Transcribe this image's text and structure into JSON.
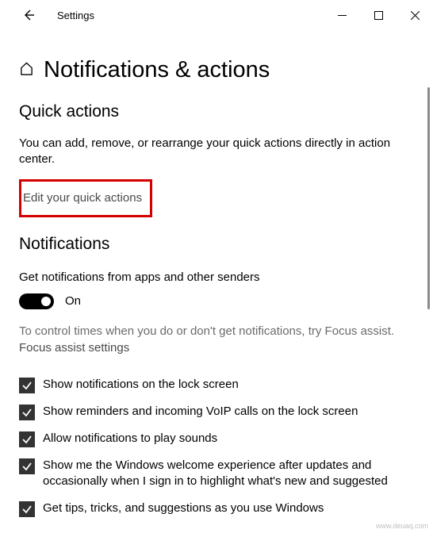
{
  "titlebar": {
    "app_name": "Settings"
  },
  "page": {
    "title": "Notifications & actions"
  },
  "quick_actions": {
    "heading": "Quick actions",
    "description": "You can add, remove, or rearrange your quick actions directly in action center.",
    "edit_link": "Edit your quick actions"
  },
  "notifications": {
    "heading": "Notifications",
    "toggle_caption": "Get notifications from apps and other senders",
    "toggle_state": "On",
    "help_text": "To control times when you do or don't get notifications, try Focus assist.",
    "focus_link": "Focus assist settings",
    "checkboxes": [
      "Show notifications on the lock screen",
      "Show reminders and incoming VoIP calls on the lock screen",
      "Allow notifications to play sounds",
      "Show me the Windows welcome experience after updates and occasionally when I sign in to highlight what's new and suggested",
      "Get tips, tricks, and suggestions as you use Windows"
    ]
  },
  "attribution": "www.deuaq.com"
}
